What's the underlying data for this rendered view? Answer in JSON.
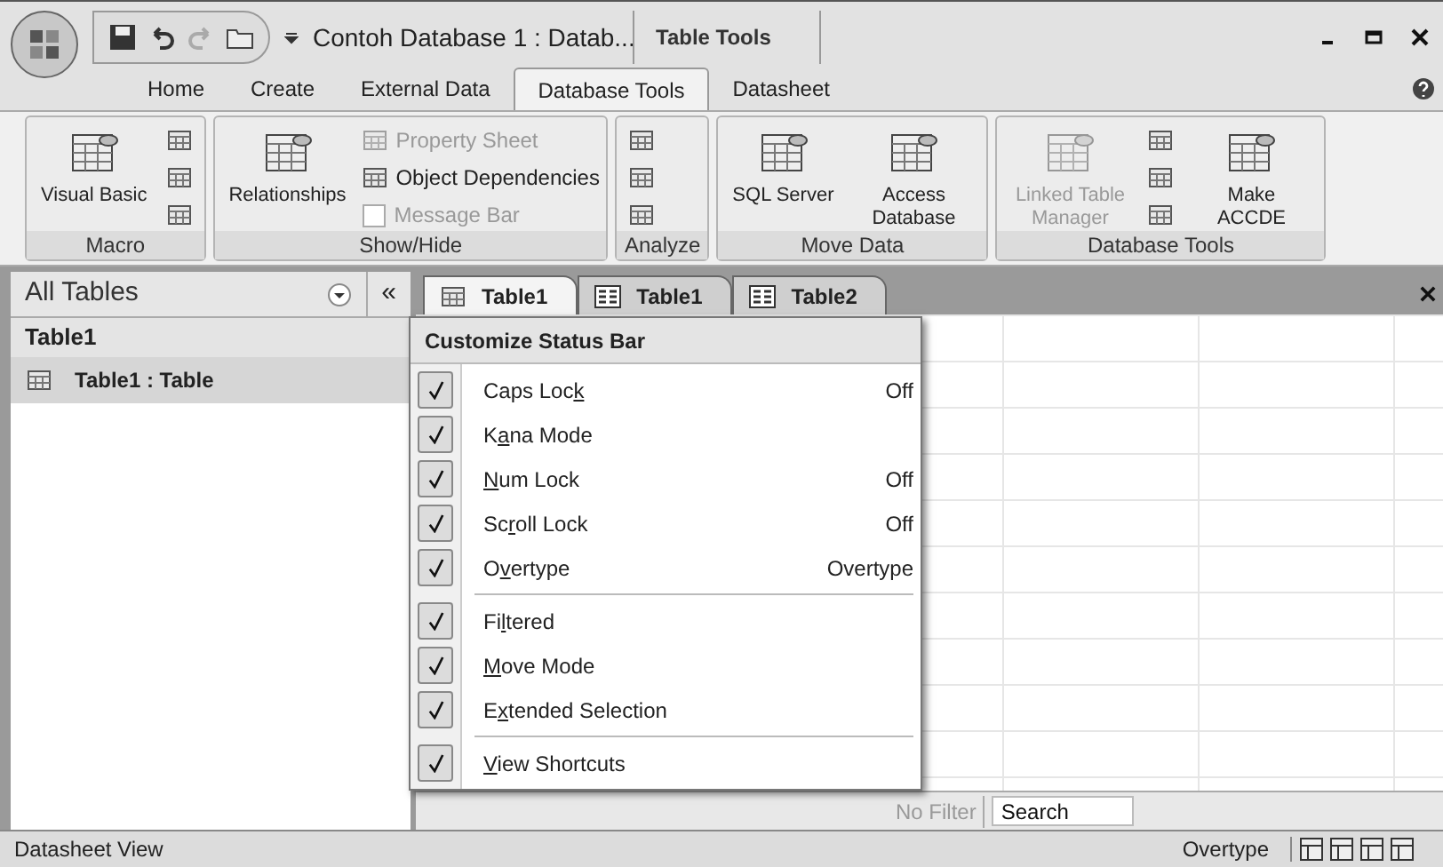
{
  "window": {
    "title": "Contoh Database 1 : Datab...",
    "contextual_group": "Table Tools"
  },
  "tabs": [
    {
      "label": "Home",
      "selected": false
    },
    {
      "label": "Create",
      "selected": false
    },
    {
      "label": "External Data",
      "selected": false
    },
    {
      "label": "Database Tools",
      "selected": true
    },
    {
      "label": "Datasheet",
      "selected": false
    }
  ],
  "ribbon": [
    {
      "name": "Macro",
      "items": [
        {
          "kind": "large",
          "label": "Visual Basic",
          "disabled": false
        },
        {
          "kind": "icon"
        },
        {
          "kind": "icon"
        },
        {
          "kind": "icon"
        }
      ]
    },
    {
      "name": "Show/Hide",
      "items": [
        {
          "kind": "large",
          "label": "Relationships",
          "disabled": false
        },
        {
          "kind": "small",
          "label": "Property Sheet",
          "disabled": true
        },
        {
          "kind": "small",
          "label": "Object Dependencies",
          "disabled": false
        },
        {
          "kind": "check",
          "label": "Message Bar",
          "disabled": true,
          "checked": false
        }
      ]
    },
    {
      "name": "Analyze",
      "items": [
        {
          "kind": "icon"
        },
        {
          "kind": "icon"
        },
        {
          "kind": "icon"
        }
      ]
    },
    {
      "name": "Move Data",
      "items": [
        {
          "kind": "large",
          "label": "SQL Server",
          "disabled": false
        },
        {
          "kind": "large",
          "label": "Access Database",
          "disabled": false
        }
      ]
    },
    {
      "name": "Database Tools",
      "items": [
        {
          "kind": "large",
          "label": "Linked Table Manager",
          "disabled": true
        },
        {
          "kind": "icon"
        },
        {
          "kind": "icon"
        },
        {
          "kind": "icon"
        },
        {
          "kind": "large",
          "label": "Make ACCDE",
          "disabled": false
        }
      ]
    }
  ],
  "nav_pane": {
    "title": "All Tables",
    "collapse": "«",
    "groups": [
      {
        "label": "Table1",
        "items": [
          {
            "label": "Table1 : Table",
            "selected": true
          }
        ]
      }
    ]
  },
  "doc_tabs": [
    {
      "label": "Table1",
      "kind": "table",
      "selected": true
    },
    {
      "label": "Table1",
      "kind": "form",
      "selected": false
    },
    {
      "label": "Table2",
      "kind": "form",
      "selected": false
    }
  ],
  "record_nav": {
    "filter": "No Filter",
    "search": {
      "placeholder": "Search"
    }
  },
  "status_bar": {
    "view": "Datasheet View",
    "mode": "Overtype"
  },
  "menu": {
    "title": "Customize Status Bar",
    "items": [
      {
        "kind": "item",
        "checked": true,
        "label_parts": {
          "before": "Caps Loc",
          "key": "k"
        },
        "value": "Off"
      },
      {
        "kind": "item",
        "checked": true,
        "label_parts": {
          "before": "K",
          "key": "a",
          "after": "na Mode"
        }
      },
      {
        "kind": "item",
        "checked": true,
        "label_parts": {
          "key": "N",
          "after": "um Lock"
        },
        "value": "Off"
      },
      {
        "kind": "item",
        "checked": true,
        "label_parts": {
          "before": "Sc",
          "key": "r",
          "after": "oll Lock"
        },
        "value": "Off"
      },
      {
        "kind": "item",
        "checked": true,
        "label_parts": {
          "before": "O",
          "key": "v",
          "after": "ertype"
        },
        "value": "Overtype"
      },
      {
        "kind": "separator"
      },
      {
        "kind": "item",
        "checked": true,
        "label_parts": {
          "before": "Fi",
          "key": "l",
          "after": "tered"
        }
      },
      {
        "kind": "item",
        "checked": true,
        "label_parts": {
          "key": "M",
          "after": "ove Mode"
        }
      },
      {
        "kind": "item",
        "checked": true,
        "label_parts": {
          "before": "E",
          "key": "x",
          "after": "tended Selection"
        }
      },
      {
        "kind": "separator"
      },
      {
        "kind": "item",
        "checked": true,
        "label_parts": {
          "key": "V",
          "after": "iew Shortcuts"
        }
      }
    ]
  }
}
